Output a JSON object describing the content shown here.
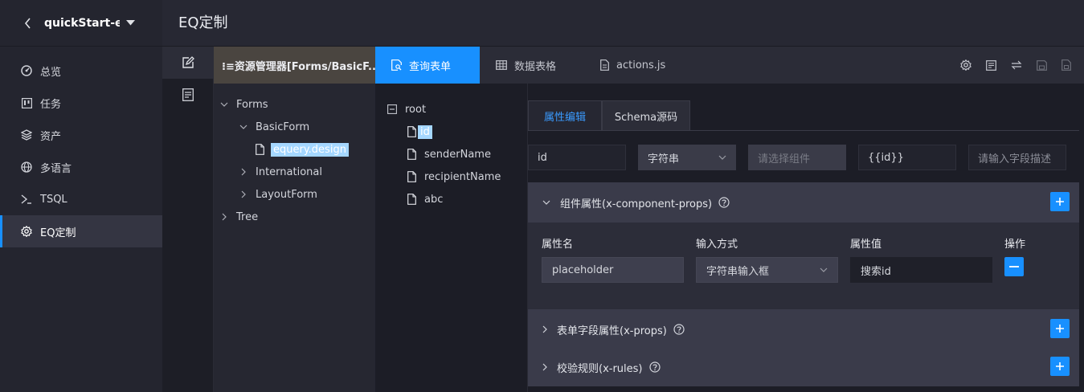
{
  "project": {
    "name": "quickStart-e..."
  },
  "nav": {
    "items": [
      {
        "label": "总览",
        "icon": "dashboard-icon"
      },
      {
        "label": "任务",
        "icon": "board-icon"
      },
      {
        "label": "资产",
        "icon": "layers-icon"
      },
      {
        "label": "多语言",
        "icon": "globe-icon"
      },
      {
        "label": "TSQL",
        "icon": "chevron-right-icon"
      },
      {
        "label": "EQ定制",
        "icon": "gear-icon",
        "active": true
      }
    ]
  },
  "header": {
    "title": "EQ定制"
  },
  "tree": {
    "title": "⁝≡资源管理器[Forms/BasicF...",
    "nodes": [
      {
        "label": "Forms",
        "expanded": true
      },
      {
        "label": "BasicForm",
        "expanded": true
      },
      {
        "label": "equery.design",
        "selected": true
      },
      {
        "label": "International",
        "expanded": false
      },
      {
        "label": "LayoutForm",
        "expanded": false
      },
      {
        "label": "Tree",
        "expanded": false
      }
    ]
  },
  "tabs": [
    {
      "label": "查询表单",
      "icon": "search-doc-icon",
      "active": true
    },
    {
      "label": "数据表格",
      "icon": "table-icon"
    },
    {
      "label": "actions.js",
      "icon": "file-icon"
    }
  ],
  "schema": {
    "root": "root",
    "fields": [
      "id",
      "senderName",
      "recipientName",
      "abc"
    ],
    "selected": "id"
  },
  "editor": {
    "tabs": [
      "属性编辑",
      "Schema源码"
    ],
    "field_name": "id",
    "type": "字符串",
    "component_placeholder": "请选择组件",
    "default_value": "{{id}}",
    "desc_placeholder": "请输入字段描述"
  },
  "component_props": {
    "title": "组件属性(x-component-props)",
    "columns": [
      "属性名",
      "输入方式",
      "属性值",
      "操作"
    ],
    "rows": [
      {
        "name": "placeholder",
        "input": "字符串输入框",
        "value": "搜索id"
      }
    ]
  },
  "xprops": {
    "title": "表单字段属性(x-props)"
  },
  "xrules": {
    "title": "校验规则(x-rules)"
  },
  "colors": {
    "accent": "#1890ff",
    "sidebar": "#24252f",
    "panel": "#3a3b4a"
  }
}
